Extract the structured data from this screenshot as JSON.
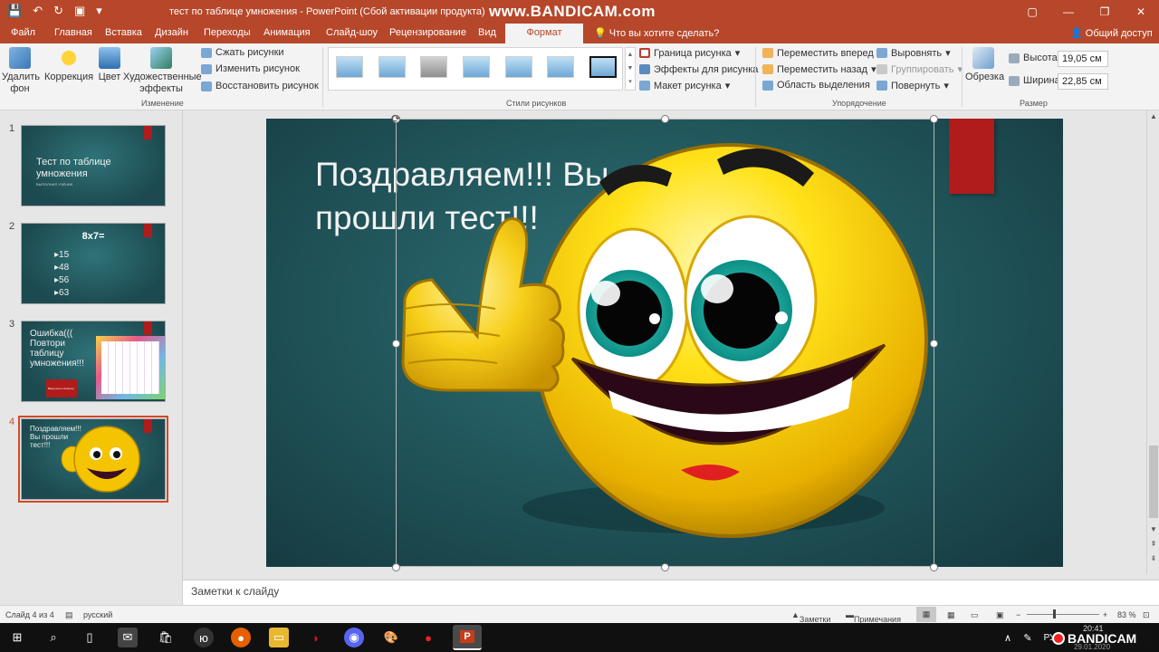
{
  "titlebar": {
    "document_title": "тест по таблице умножения - PowerPoint (Сбой активации продукта)",
    "watermark": "www.BANDICAM.com",
    "min": "—",
    "restore": "❐",
    "close": "✕",
    "ribbon_opts": "▢"
  },
  "tabs": [
    "Файл",
    "Главная",
    "Вставка",
    "Дизайн",
    "Переходы",
    "Анимация",
    "Слайд-шоу",
    "Рецензирование",
    "Вид",
    "Формат"
  ],
  "search": "Что вы хотите сделать?",
  "share": "Общий доступ",
  "ribbon": {
    "remove_bg": [
      "Удалить",
      "фон"
    ],
    "correction": "Коррекция",
    "color": "Цвет",
    "artistic": [
      "Художественные",
      "эффекты"
    ],
    "compress": "Сжать рисунки",
    "change": "Изменить рисунок",
    "reset": "Восстановить рисунок",
    "group_adjust": "Изменение",
    "group_styles": "Стили рисунков",
    "border": "Граница рисунка",
    "effects": "Эффекты для рисунка",
    "layout": "Макет рисунка",
    "forward": "Переместить вперед",
    "backward": "Переместить назад",
    "selection_pane": "Область выделения",
    "align": "Выровнять",
    "group": "Группировать",
    "rotate": "Повернуть",
    "group_arrange": "Упорядочение",
    "crop": "Обрезка",
    "height_label": "Высота:",
    "height_value": "19,05 см",
    "width_label": "Ширина:",
    "width_value": "22,85 см",
    "group_size": "Размер"
  },
  "slides": [
    {
      "num": "1",
      "title": "Тест по таблице умножения",
      "subtitle": "ВЫПОЛНИЛ УЧЕНИК"
    },
    {
      "num": "2",
      "title": "8x7=",
      "items": [
        "15",
        "48",
        "56",
        "63"
      ]
    },
    {
      "num": "3",
      "title": "Ошибка((( Повтори таблицу умножения!!!",
      "button": "Вернуться к вопросу"
    },
    {
      "num": "4",
      "title": "Поздравляем!!! Вы прошли тест!!!"
    }
  ],
  "current_slide_title": "Поздравляем!!! Вы прошли тест!!!",
  "notes_placeholder": "Заметки к слайду",
  "status": {
    "slide_info": "Слайд 4 из 4",
    "language": "русский",
    "notes": "Заметки",
    "comments": "Примечания",
    "zoom": "83 %"
  },
  "taskbar": {
    "time": "20:41",
    "date": "29.01.2020",
    "lang": "РУ"
  },
  "colors": {
    "accent": "#b7472a",
    "slide_bg": "#22595e",
    "red_tab": "#b01b1b"
  }
}
